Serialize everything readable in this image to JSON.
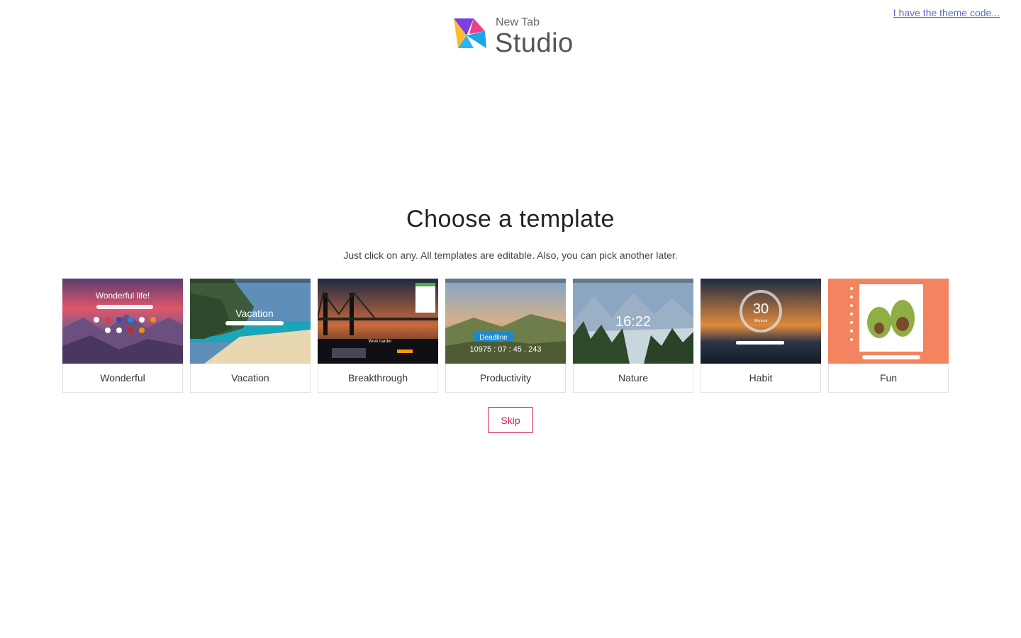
{
  "header": {
    "theme_code_link": "I have the theme code...",
    "logo_small": "New Tab",
    "logo_big": "Studio"
  },
  "main": {
    "title": "Choose a template",
    "subtitle": "Just click on any. All templates are editable. Also, you can pick another later.",
    "skip_label": "Skip"
  },
  "templates": [
    {
      "label": "Wonderful",
      "overlay": "Wonderful life!"
    },
    {
      "label": "Vacation",
      "overlay": "Vacation"
    },
    {
      "label": "Breakthrough",
      "overlay": "Work harder"
    },
    {
      "label": "Productivity",
      "overlay": "Deadline",
      "timer": "10975 : 07 : 45 . 243"
    },
    {
      "label": "Nature",
      "overlay": "16:22"
    },
    {
      "label": "Habit",
      "overlay": "30",
      "sub": "Workout"
    },
    {
      "label": "Fun",
      "overlay": ""
    }
  ],
  "colors": {
    "link": "#5c6bc0",
    "skip_accent": "#d81b60",
    "fun_bg": "#f4845f"
  }
}
